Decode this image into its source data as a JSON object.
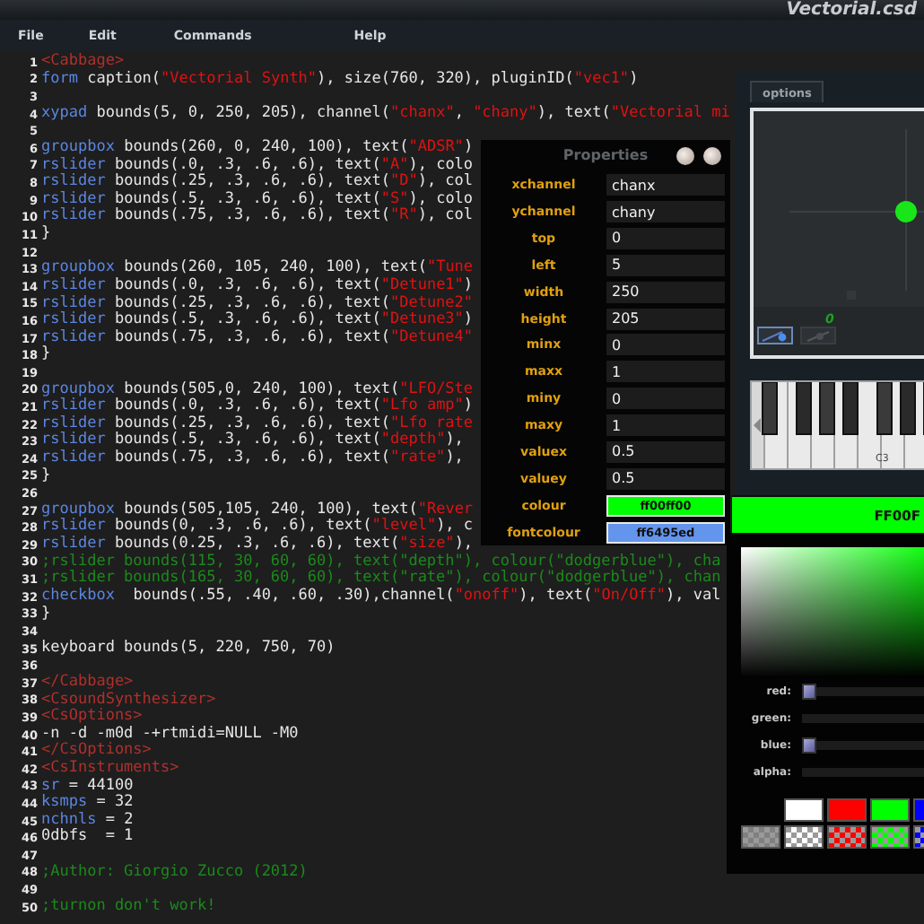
{
  "window": {
    "title": "Vectorial.csd"
  },
  "menu": [
    "File",
    "Edit",
    "Commands",
    "Help"
  ],
  "editor": {
    "lines": [
      {
        "n": "1",
        "parts": [
          {
            "kind": "tag",
            "text": "<Cabbage>"
          }
        ]
      },
      {
        "n": "2",
        "parts": [
          {
            "kind": "kw",
            "text": "form"
          },
          {
            "kind": "txt",
            "text": " caption("
          },
          {
            "kind": "str",
            "text": "\"Vectorial Synth\""
          },
          {
            "kind": "txt",
            "text": "), size(760, 320), pluginID("
          },
          {
            "kind": "str",
            "text": "\"vec1\""
          },
          {
            "kind": "txt",
            "text": ")"
          }
        ]
      },
      {
        "n": "3"
      },
      {
        "n": "4",
        "parts": [
          {
            "kind": "kw",
            "text": "xypad"
          },
          {
            "kind": "txt",
            "text": " bounds(5, 0, 250, 205), channel("
          },
          {
            "kind": "str",
            "text": "\"chanx\""
          },
          {
            "kind": "txt",
            "text": ", "
          },
          {
            "kind": "str",
            "text": "\"chany\""
          },
          {
            "kind": "txt",
            "text": "), text("
          },
          {
            "kind": "str",
            "text": "\"Vectorial mi"
          }
        ]
      },
      {
        "n": "5"
      },
      {
        "n": "6",
        "parts": [
          {
            "kind": "kw",
            "text": "groupbox"
          },
          {
            "kind": "txt",
            "text": " bounds(260, 0, 240, 100), text("
          },
          {
            "kind": "str",
            "text": "\"ADSR\""
          },
          {
            "kind": "txt",
            "text": ")"
          }
        ]
      },
      {
        "n": "7",
        "parts": [
          {
            "kind": "kw",
            "text": "rslider"
          },
          {
            "kind": "txt",
            "text": " bounds(.0, .3, .6, .6), text("
          },
          {
            "kind": "str",
            "text": "\"A\""
          },
          {
            "kind": "txt",
            "text": "), colo"
          }
        ]
      },
      {
        "n": "8",
        "parts": [
          {
            "kind": "kw",
            "text": "rslider"
          },
          {
            "kind": "txt",
            "text": " bounds(.25, .3, .6, .6), text("
          },
          {
            "kind": "str",
            "text": "\"D\""
          },
          {
            "kind": "txt",
            "text": "), col"
          }
        ]
      },
      {
        "n": "9",
        "parts": [
          {
            "kind": "kw",
            "text": "rslider"
          },
          {
            "kind": "txt",
            "text": " bounds(.5, .3, .6, .6), text("
          },
          {
            "kind": "str",
            "text": "\"S\""
          },
          {
            "kind": "txt",
            "text": "), colo"
          }
        ]
      },
      {
        "n": "10",
        "parts": [
          {
            "kind": "kw",
            "text": "rslider"
          },
          {
            "kind": "txt",
            "text": " bounds(.75, .3, .6, .6), text("
          },
          {
            "kind": "str",
            "text": "\"R\""
          },
          {
            "kind": "txt",
            "text": "), col"
          }
        ]
      },
      {
        "n": "11",
        "parts": [
          {
            "kind": "txt",
            "text": "}"
          }
        ]
      },
      {
        "n": "12"
      },
      {
        "n": "13",
        "parts": [
          {
            "kind": "kw",
            "text": "groupbox"
          },
          {
            "kind": "txt",
            "text": " bounds(260, 105, 240, 100), text("
          },
          {
            "kind": "str",
            "text": "\"Tune"
          }
        ]
      },
      {
        "n": "14",
        "parts": [
          {
            "kind": "kw",
            "text": "rslider"
          },
          {
            "kind": "txt",
            "text": " bounds(.0, .3, .6, .6), text("
          },
          {
            "kind": "str",
            "text": "\"Detune1\""
          },
          {
            "kind": "txt",
            "text": ")"
          }
        ]
      },
      {
        "n": "15",
        "parts": [
          {
            "kind": "kw",
            "text": "rslider"
          },
          {
            "kind": "txt",
            "text": " bounds(.25, .3, .6, .6), text("
          },
          {
            "kind": "str",
            "text": "\"Detune2\""
          }
        ]
      },
      {
        "n": "16",
        "parts": [
          {
            "kind": "kw",
            "text": "rslider"
          },
          {
            "kind": "txt",
            "text": " bounds(.5, .3, .6, .6), text("
          },
          {
            "kind": "str",
            "text": "\"Detune3\""
          },
          {
            "kind": "txt",
            "text": ")"
          }
        ]
      },
      {
        "n": "17",
        "parts": [
          {
            "kind": "kw",
            "text": "rslider"
          },
          {
            "kind": "txt",
            "text": " bounds(.75, .3, .6, .6), text("
          },
          {
            "kind": "str",
            "text": "\"Detune4\""
          }
        ]
      },
      {
        "n": "18",
        "parts": [
          {
            "kind": "txt",
            "text": "}"
          }
        ]
      },
      {
        "n": "19"
      },
      {
        "n": "20",
        "parts": [
          {
            "kind": "kw",
            "text": "groupbox"
          },
          {
            "kind": "txt",
            "text": " bounds(505,0, 240, 100), text("
          },
          {
            "kind": "str",
            "text": "\"LFO/Ste"
          }
        ]
      },
      {
        "n": "21",
        "parts": [
          {
            "kind": "kw",
            "text": "rslider"
          },
          {
            "kind": "txt",
            "text": " bounds(.0, .3, .6, .6), text("
          },
          {
            "kind": "str",
            "text": "\"Lfo amp\""
          },
          {
            "kind": "txt",
            "text": ")"
          }
        ]
      },
      {
        "n": "22",
        "parts": [
          {
            "kind": "kw",
            "text": "rslider"
          },
          {
            "kind": "txt",
            "text": " bounds(.25, .3, .6, .6), text("
          },
          {
            "kind": "str",
            "text": "\"Lfo rate"
          }
        ]
      },
      {
        "n": "23",
        "parts": [
          {
            "kind": "kw",
            "text": "rslider"
          },
          {
            "kind": "txt",
            "text": " bounds(.5, .3, .6, .6), text("
          },
          {
            "kind": "str",
            "text": "\"depth\""
          },
          {
            "kind": "txt",
            "text": "),"
          }
        ]
      },
      {
        "n": "24",
        "parts": [
          {
            "kind": "kw",
            "text": "rslider"
          },
          {
            "kind": "txt",
            "text": " bounds(.75, .3, .6, .6), text("
          },
          {
            "kind": "str",
            "text": "\"rate\""
          },
          {
            "kind": "txt",
            "text": "),"
          }
        ]
      },
      {
        "n": "25",
        "parts": [
          {
            "kind": "txt",
            "text": "}"
          }
        ]
      },
      {
        "n": "26"
      },
      {
        "n": "27",
        "parts": [
          {
            "kind": "kw",
            "text": "groupbox"
          },
          {
            "kind": "txt",
            "text": " bounds(505,105, 240, 100), text("
          },
          {
            "kind": "str",
            "text": "\"Rever"
          }
        ]
      },
      {
        "n": "28",
        "parts": [
          {
            "kind": "kw",
            "text": "rslider"
          },
          {
            "kind": "txt",
            "text": " bounds(0, .3, .6, .6), text("
          },
          {
            "kind": "str",
            "text": "\"level\""
          },
          {
            "kind": "txt",
            "text": "), c"
          }
        ]
      },
      {
        "n": "29",
        "parts": [
          {
            "kind": "kw",
            "text": "rslider"
          },
          {
            "kind": "txt",
            "text": " bounds(0.25, .3, .6, .6), text("
          },
          {
            "kind": "str",
            "text": "\"size\""
          },
          {
            "kind": "txt",
            "text": "),"
          }
        ]
      },
      {
        "n": "30",
        "parts": [
          {
            "kind": "com",
            "text": ";rslider bounds(115, 30, 60, 60), text(\"depth\"), colour(\"dodgerblue\"), cha"
          }
        ]
      },
      {
        "n": "31",
        "parts": [
          {
            "kind": "com",
            "text": ";rslider bounds(165, 30, 60, 60), text(\"rate\"), colour(\"dodgerblue\"), chan"
          }
        ]
      },
      {
        "n": "32",
        "parts": [
          {
            "kind": "kw",
            "text": "checkbox"
          },
          {
            "kind": "txt",
            "text": "  bounds(.55, .40, .60, .30),channel("
          },
          {
            "kind": "str",
            "text": "\"onoff\""
          },
          {
            "kind": "txt",
            "text": "), text("
          },
          {
            "kind": "str",
            "text": "\"On/Off\""
          },
          {
            "kind": "txt",
            "text": "), val"
          }
        ]
      },
      {
        "n": "33",
        "parts": [
          {
            "kind": "txt",
            "text": "}"
          }
        ]
      },
      {
        "n": "34"
      },
      {
        "n": "35",
        "parts": [
          {
            "kind": "txt",
            "text": "keyboard bounds(5, 220, 750, 70)"
          }
        ]
      },
      {
        "n": "36"
      },
      {
        "n": "37",
        "parts": [
          {
            "kind": "tag",
            "text": "</Cabbage>"
          }
        ]
      },
      {
        "n": "38",
        "parts": [
          {
            "kind": "tag",
            "text": "<CsoundSynthesizer>"
          }
        ]
      },
      {
        "n": "39",
        "parts": [
          {
            "kind": "tag",
            "text": "<CsOptions>"
          }
        ]
      },
      {
        "n": "40",
        "parts": [
          {
            "kind": "txt",
            "text": "-n -d -m0d -+rtmidi=NULL -M0"
          }
        ]
      },
      {
        "n": "41",
        "parts": [
          {
            "kind": "tag",
            "text": "</CsOptions>"
          }
        ]
      },
      {
        "n": "42",
        "parts": [
          {
            "kind": "tag",
            "text": "<CsInstruments>"
          }
        ]
      },
      {
        "n": "43",
        "parts": [
          {
            "kind": "kw",
            "text": "sr"
          },
          {
            "kind": "txt",
            "text": " = 44100"
          }
        ]
      },
      {
        "n": "44",
        "parts": [
          {
            "kind": "kw",
            "text": "ksmps"
          },
          {
            "kind": "txt",
            "text": " = 32"
          }
        ]
      },
      {
        "n": "45",
        "parts": [
          {
            "kind": "kw",
            "text": "nchnls"
          },
          {
            "kind": "txt",
            "text": " = 2"
          }
        ]
      },
      {
        "n": "46",
        "parts": [
          {
            "kind": "txt",
            "text": "0dbfs  = 1"
          }
        ]
      },
      {
        "n": "47"
      },
      {
        "n": "48",
        "parts": [
          {
            "kind": "com",
            "text": ";Author: Giorgio Zucco (2012)"
          }
        ]
      },
      {
        "n": "49"
      },
      {
        "n": "50",
        "parts": [
          {
            "kind": "com",
            "text": ";turnon don't work!"
          }
        ]
      }
    ]
  },
  "properties": {
    "title": "Properties",
    "rows": [
      {
        "kind": "text",
        "label": "xchannel",
        "value": "chanx"
      },
      {
        "kind": "text",
        "label": "ychannel",
        "value": "chany"
      },
      {
        "kind": "text",
        "label": "top",
        "value": "0"
      },
      {
        "kind": "text",
        "label": "left",
        "value": "5"
      },
      {
        "kind": "text",
        "label": "width",
        "value": "250"
      },
      {
        "kind": "text",
        "label": "height",
        "value": "205"
      },
      {
        "kind": "text",
        "label": "minx",
        "value": "0"
      },
      {
        "kind": "text",
        "label": "maxx",
        "value": "1"
      },
      {
        "kind": "text",
        "label": "miny",
        "value": "0"
      },
      {
        "kind": "text",
        "label": "maxy",
        "value": "1"
      },
      {
        "kind": "text",
        "label": "valuex",
        "value": "0.5"
      },
      {
        "kind": "text",
        "label": "valuey",
        "value": "0.5"
      },
      {
        "kind": "colour",
        "label": "colour",
        "value": "ff00ff00",
        "color": "#00ff00"
      },
      {
        "kind": "colour",
        "label": "fontcolour",
        "value": "ff6495ed",
        "color": "#6495ed"
      }
    ]
  },
  "plugin": {
    "tab": "options",
    "xy_value": "0",
    "keyboard_label": "C3"
  },
  "colour_bar": {
    "text": "FF00F",
    "color": "#00ff00"
  },
  "colour_picker": {
    "sliders": [
      {
        "label": "red:",
        "level": 0
      },
      {
        "label": "green:"
      },
      {
        "label": "blue:",
        "level": 0
      },
      {
        "label": "alpha:"
      }
    ],
    "swatch_rows": [
      [
        {
          "kind": "solid",
          "color": "#ffffff"
        },
        {
          "kind": "solid",
          "color": "#ff0000"
        },
        {
          "kind": "solid",
          "color": "#00ff00"
        },
        {
          "kind": "solid",
          "color": "#0000ff"
        }
      ],
      [
        {
          "kind": "translucent",
          "color": "#808080"
        },
        {
          "kind": "translucent",
          "color": "#ffffff"
        },
        {
          "kind": "translucent",
          "color": "#ff0000"
        },
        {
          "kind": "translucent",
          "color": "#00ff00"
        },
        {
          "kind": "translucent",
          "color": "#0000ff"
        }
      ]
    ]
  }
}
